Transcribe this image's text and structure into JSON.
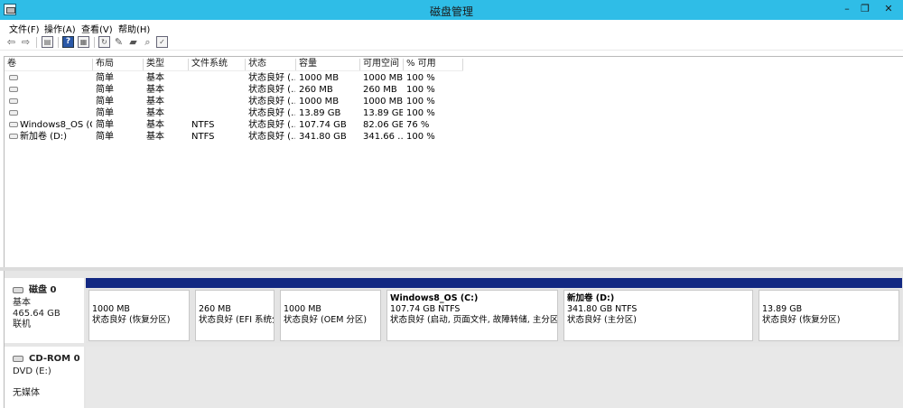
{
  "window": {
    "title": "磁盘管理",
    "minimize": "–",
    "restore": "❐",
    "close": "✕"
  },
  "menu": [
    "文件(F)",
    "操作(A)",
    "查看(V)",
    "帮助(H)"
  ],
  "toolbar_icons": [
    "back-arrow-icon",
    "forward-arrow-icon",
    "console-tree-icon",
    "help-icon",
    "properties-icon",
    "refresh-icon",
    "export-icon",
    "open-icon",
    "rescan-icon",
    "settings-icon"
  ],
  "volume_list": {
    "columns": [
      "卷",
      "布局",
      "类型",
      "文件系统",
      "状态",
      "容量",
      "可用空间",
      "% 可用"
    ],
    "rows": [
      [
        "",
        "简单",
        "基本",
        "",
        "状态良好 (…",
        "1000 MB",
        "1000 MB",
        "100 %"
      ],
      [
        "",
        "简单",
        "基本",
        "",
        "状态良好 (…",
        "260 MB",
        "260 MB",
        "100 %"
      ],
      [
        "",
        "简单",
        "基本",
        "",
        "状态良好 (…",
        "1000 MB",
        "1000 MB",
        "100 %"
      ],
      [
        "",
        "简单",
        "基本",
        "",
        "状态良好 (…",
        "13.89 GB",
        "13.89 GB",
        "100 %"
      ],
      [
        "Windows8_OS (C:)",
        "简单",
        "基本",
        "NTFS",
        "状态良好 (…",
        "107.74 GB",
        "82.06 GB",
        "76 %"
      ],
      [
        "新加卷 (D:)",
        "简单",
        "基本",
        "NTFS",
        "状态良好 (…",
        "341.80 GB",
        "341.66 …",
        "100 %"
      ]
    ]
  },
  "disk0": {
    "name": "磁盘 0",
    "type": "基本",
    "size": "465.64 GB",
    "status": "联机",
    "partitions": [
      {
        "name": "",
        "size": "1000 MB",
        "status": "状态良好 (恢复分区)"
      },
      {
        "name": "",
        "size": "260 MB",
        "status": "状态良好 (EFI 系统分区)"
      },
      {
        "name": "",
        "size": "1000 MB",
        "status": "状态良好 (OEM 分区)"
      },
      {
        "name": "Windows8_OS  (C:)",
        "size": "107.74 GB NTFS",
        "status": "状态良好 (启动, 页面文件, 故障转储, 主分区)"
      },
      {
        "name": "新加卷  (D:)",
        "size": "341.80 GB NTFS",
        "status": "状态良好 (主分区)"
      },
      {
        "name": "",
        "size": "13.89 GB",
        "status": "状态良好 (恢复分区)"
      }
    ]
  },
  "cdrom0": {
    "name": "CD-ROM 0",
    "type": "DVD (E:)",
    "media": "无媒体"
  }
}
